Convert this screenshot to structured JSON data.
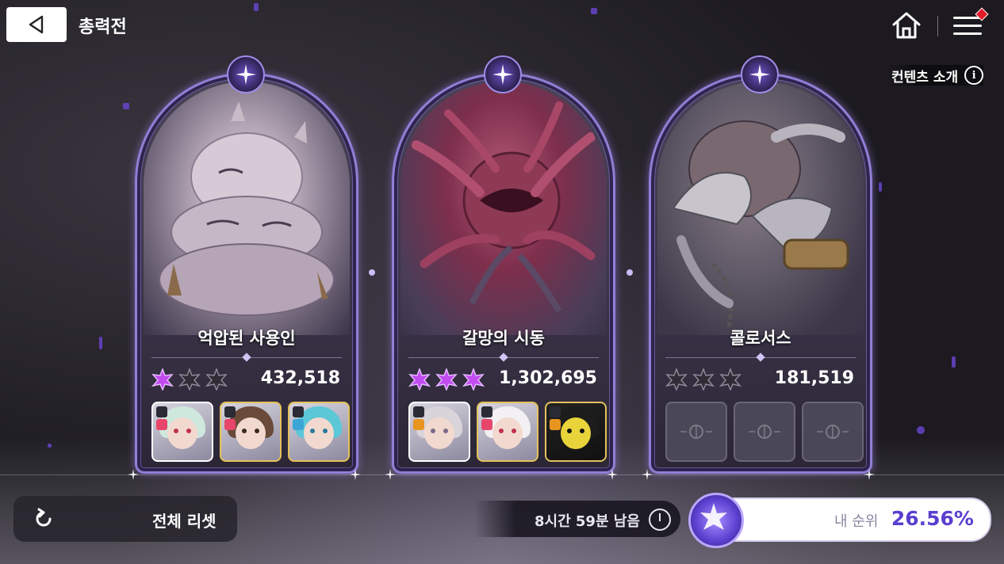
{
  "header": {
    "title": "총력전",
    "content_intro": "컨텐츠 소개",
    "info_symbol": "i"
  },
  "bosses": [
    {
      "name": "억압된 사용인",
      "score": "432,518",
      "stars": [
        true,
        false,
        false
      ],
      "art_color": "#c9bcc9",
      "team": [
        "filled",
        "filled",
        "filled"
      ]
    },
    {
      "name": "갈망의 시동",
      "score": "1,302,695",
      "stars": [
        true,
        true,
        true
      ],
      "art_color": "#8e3a55",
      "team": [
        "filled",
        "filled",
        "filled"
      ]
    },
    {
      "name": "콜로서스",
      "score": "181,519",
      "stars": [
        false,
        false,
        false
      ],
      "art_color": "#8a8a94",
      "team": [
        "empty",
        "empty",
        "empty"
      ]
    }
  ],
  "footer": {
    "reset_label": "전체 리셋",
    "timer_text": "8시간 59분 남음",
    "rank_label": "내 순위",
    "rank_value": "26.56%"
  },
  "colors": {
    "accent": "#5a3fcf",
    "frame": "#8f80d6",
    "notification": "#e21a2a"
  }
}
